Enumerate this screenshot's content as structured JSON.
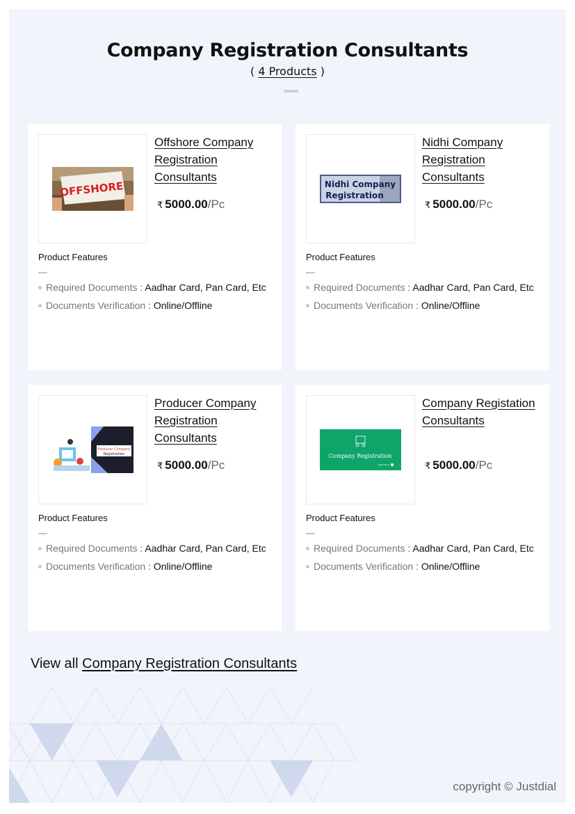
{
  "header": {
    "title": "Company Registration Consultants",
    "count_open": "( ",
    "count": "4 Products",
    "count_close": " )"
  },
  "products": [
    {
      "title": "Offshore Company Registration Consultants",
      "currency_symbol": "₹",
      "price": "5000.00",
      "unit": "/Pc",
      "image_text": "OFFSHORE",
      "features_heading": "Product Features",
      "features": [
        {
          "key": "Required Documents",
          "sep": " : ",
          "value": "Aadhar Card, Pan Card, Etc"
        },
        {
          "key": "Documents Verification",
          "sep": " : ",
          "value": "Online/Offline"
        }
      ]
    },
    {
      "title": "Nidhi Company Registration Consultants",
      "currency_symbol": "₹",
      "price": "5000.00",
      "unit": "/Pc",
      "image_text_line1": "Nidhi Company",
      "image_text_line2": "Registration",
      "features_heading": "Product Features",
      "features": [
        {
          "key": "Required Documents",
          "sep": " : ",
          "value": "Aadhar Card, Pan Card, Etc"
        },
        {
          "key": "Documents Verification",
          "sep": " : ",
          "value": "Online/Offline"
        }
      ]
    },
    {
      "title": "Producer Company Registration Consultants",
      "currency_symbol": "₹",
      "price": "5000.00",
      "unit": "/Pc",
      "image_text_line1": "Producer Company",
      "image_text_line2": "Registration",
      "features_heading": "Product Features",
      "features": [
        {
          "key": "Required Documents",
          "sep": " : ",
          "value": "Aadhar Card, Pan Card, Etc"
        },
        {
          "key": "Documents Verification",
          "sep": " : ",
          "value": "Online/Offline"
        }
      ]
    },
    {
      "title": "Company Registation Consultants",
      "currency_symbol": "₹",
      "price": "5000.00",
      "unit": "/Pc",
      "image_text": "Company Registration",
      "image_small_text": "Read More",
      "features_heading": "Product Features",
      "features": [
        {
          "key": "Required Documents",
          "sep": " : ",
          "value": "Aadhar Card, Pan Card, Etc"
        },
        {
          "key": "Documents Verification",
          "sep": " : ",
          "value": "Online/Offline"
        }
      ]
    }
  ],
  "footer": {
    "view_all_prefix": "View all ",
    "view_all_link": "Company Registration Consultants",
    "copyright": "copyright © Justdial"
  },
  "colors": {
    "page_bg": "#f1f5fb",
    "card_bg": "#ffffff",
    "accent_rule": "#c7cfe6",
    "green_banner": "#0ea56a"
  }
}
